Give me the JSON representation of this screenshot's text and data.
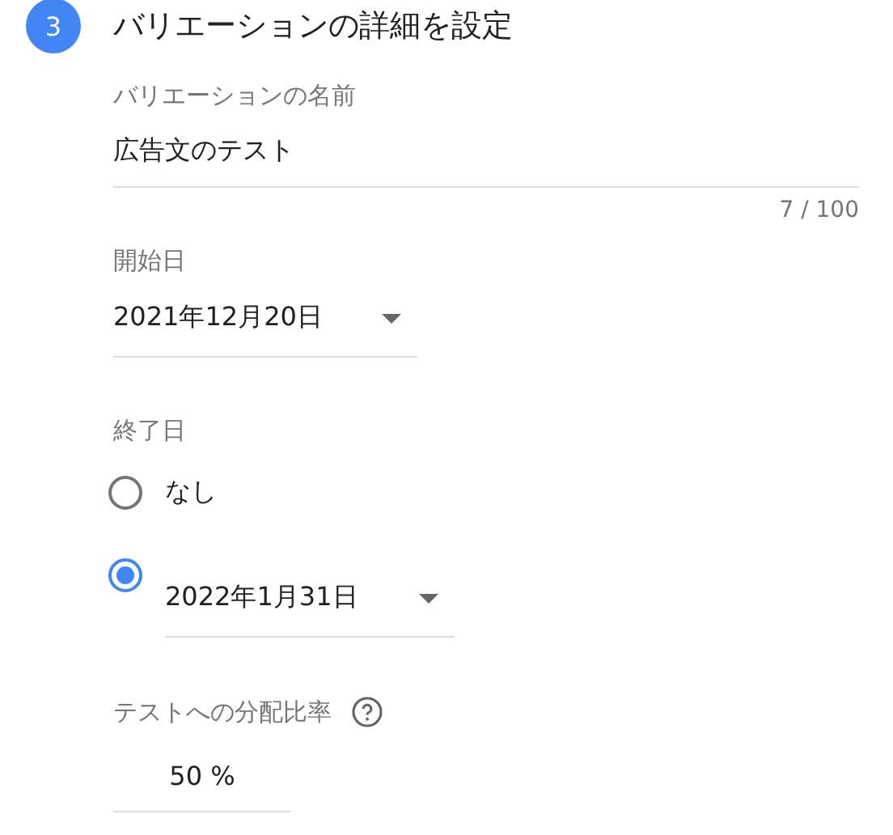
{
  "step": {
    "number": "3",
    "title": "バリエーションの詳細を設定"
  },
  "name_field": {
    "label": "バリエーションの名前",
    "value": "広告文のテスト",
    "counter": "7 / 100"
  },
  "start_date": {
    "label": "開始日",
    "value": "2021年12月20日"
  },
  "end_date": {
    "label": "終了日",
    "options": [
      {
        "kind": "plain",
        "label": "なし",
        "selected": false
      },
      {
        "kind": "date",
        "label": "2022年1月31日",
        "selected": true
      }
    ]
  },
  "allocation": {
    "label": "テストへの分配比率",
    "value": "50 %"
  }
}
